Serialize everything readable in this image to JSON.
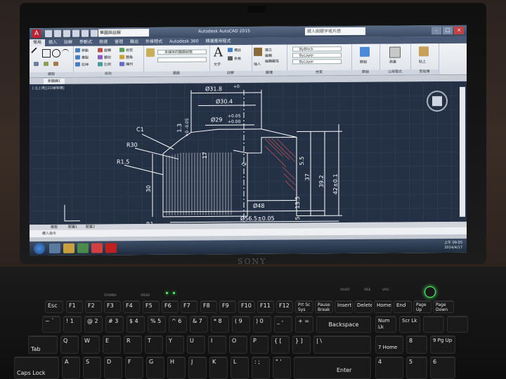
{
  "autocad": {
    "workspace_select": "草圖與註解",
    "window_title": "Autodesk AutoCAD 2015",
    "search_placeholder": "鍵入關鍵字或片語",
    "ribbon_tabs": [
      "常用",
      "插入",
      "註解",
      "參數式",
      "檢視",
      "管理",
      "輸出",
      "外掛程式",
      "Autodesk 360",
      "精選應用程式"
    ],
    "panel_labels": [
      "繪製",
      "修改",
      "圖層",
      "註解",
      "圖塊",
      "性質",
      "群組",
      "公用程式",
      "剪貼簿"
    ],
    "ribbon_texts": {
      "move": "移動",
      "rotate": "旋轉",
      "trim": "修剪",
      "copy": "複製",
      "mirror": "鏡射",
      "fillet": "圓角",
      "stretch": "拉伸",
      "scale": "比例",
      "array": "陣列",
      "text": "文字",
      "dim": "標註",
      "table": "表格",
      "layer_state": "未儲存的圖層狀態",
      "insert": "插入",
      "create": "建立",
      "edit": "編輯",
      "edit_attr": "編輯屬性",
      "bylayer1": "ByBlock",
      "bylayer2": "ByLayer",
      "bylayer3": "ByLayer",
      "group": "群組",
      "measure": "測量",
      "paste": "貼上"
    },
    "doc_tab": "新圖面1",
    "view_label": "[-][上視][2D線架構]",
    "dims": {
      "d1": "Ø31.8",
      "d1tol": "+0",
      "d2": "Ø30.4",
      "d3": "Ø29",
      "d3up": "+0.05",
      "d3dn": "+0.00",
      "c1": "C1",
      "r30": "R30",
      "r15": "R1.5",
      "r1": "R1",
      "t1": "1.3",
      "t1tol": "+0  -0.05",
      "v17": "17",
      "v2": "2",
      "v30": "30",
      "v55": "5.5",
      "v37": "37",
      "v392": "39.2",
      "v42": "42±0.1",
      "d48": "Ø48",
      "v135": "13.5",
      "v5": "5",
      "d565": "Ø56.5±0.05"
    },
    "model_tabs": [
      "模型",
      "配置1",
      "配置2"
    ],
    "command_prompt": "鍵入指令",
    "clock": {
      "time": "上午 09:05",
      "date": "2014/4/17"
    }
  },
  "brand": "SONY",
  "keyboard": {
    "row_fn": [
      "Esc",
      "F1",
      "F2",
      "F3",
      "F4",
      "F5",
      "F6",
      "F7",
      "F8",
      "F9",
      "F10",
      "F11",
      "F12",
      "Pause Break",
      "Insert",
      "Delete",
      "Home",
      "End",
      "Page Up",
      "Page Down"
    ],
    "prt": "Prt Sc Sys Rq",
    "row_num": [
      "~ `",
      "! 1",
      "@ 2",
      "# 3",
      "$ 4",
      "% 5",
      "^ 6",
      "& 7",
      "* 8",
      "( 9",
      ") 0",
      "_ -",
      "+ ="
    ],
    "backspace": "Backspace",
    "numlk": "Num Lk",
    "scrlk": "Scr Lk",
    "tab": "Tab",
    "row_q": [
      "Q",
      "W",
      "E",
      "R",
      "T",
      "Y",
      "U",
      "I",
      "O",
      "P",
      "{ [",
      "} ]",
      "| \\"
    ],
    "caps": "Caps Lock",
    "row_a": [
      "A",
      "S",
      "D",
      "F",
      "G",
      "H",
      "J",
      "K",
      "L",
      ": ;",
      "\" '"
    ],
    "enter": "Enter",
    "num_row1": [
      "7 Home",
      "8",
      "9 Pg Up"
    ],
    "num_row2": [
      "4",
      "5",
      "6"
    ],
    "assist": "ASSIST",
    "web": "WEB",
    "vaio": "VAIO",
    "stamina": "STAMINA",
    "speed": "SPEED"
  }
}
